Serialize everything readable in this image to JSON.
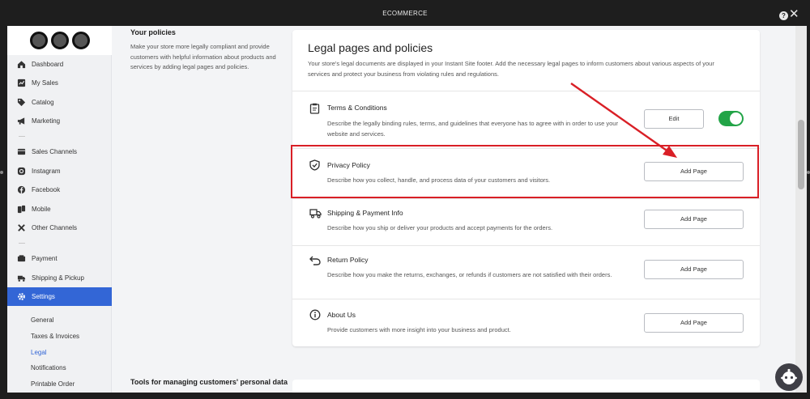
{
  "window": {
    "title": "ECOMMERCE"
  },
  "sidebar": {
    "items": [
      {
        "label": "Dashboard",
        "icon": "home-icon"
      },
      {
        "label": "My Sales",
        "icon": "sales-icon"
      },
      {
        "label": "Catalog",
        "icon": "tag-icon"
      },
      {
        "label": "Marketing",
        "icon": "megaphone-icon"
      },
      {
        "label": "Sales Channels",
        "icon": "channels-icon"
      },
      {
        "label": "Instagram",
        "icon": "instagram-icon"
      },
      {
        "label": "Facebook",
        "icon": "facebook-icon"
      },
      {
        "label": "Mobile",
        "icon": "mobile-icon"
      },
      {
        "label": "Other Channels",
        "icon": "tools-icon"
      },
      {
        "label": "Payment",
        "icon": "wallet-icon"
      },
      {
        "label": "Shipping & Pickup",
        "icon": "truck-icon"
      },
      {
        "label": "Settings",
        "icon": "gear-icon",
        "active": true
      }
    ],
    "subitems": [
      {
        "label": "General"
      },
      {
        "label": "Taxes & Invoices"
      },
      {
        "label": "Legal",
        "active": true
      },
      {
        "label": "Notifications"
      },
      {
        "label": "Printable Order"
      }
    ]
  },
  "policies_section": {
    "heading": "Your policies",
    "description": "Make your store more legally compliant and provide customers with helpful information about products and services by adding legal pages and policies."
  },
  "card": {
    "title": "Legal pages and policies",
    "description": "Your store's legal documents are displayed in your Instant Site footer. Add the necessary legal pages to inform customers about various aspects of your services and protect your business from violating rules and regulations.",
    "rows": [
      {
        "title": "Terms & Conditions",
        "description": "Describe the legally binding rules, terms, and guidelines that everyone has to agree with in order to use your website and services.",
        "button": "Edit",
        "icon": "clipboard-icon",
        "toggle_on": true
      },
      {
        "title": "Privacy Policy",
        "description": "Describe how you collect, handle, and process data of your customers and visitors.",
        "button": "Add Page",
        "icon": "shield-icon"
      },
      {
        "title": "Shipping & Payment Info",
        "description": "Describe how you ship or deliver your products and accept payments for the orders.",
        "button": "Add Page",
        "icon": "truck-icon"
      },
      {
        "title": "Return Policy",
        "description": "Describe how you make the returns, exchanges, or refunds if customers are not satisfied with their orders.",
        "button": "Add Page",
        "icon": "return-arrow-icon"
      },
      {
        "title": "About Us",
        "description": "Provide customers with more insight into your business and product.",
        "button": "Add Page",
        "icon": "info-icon"
      }
    ]
  },
  "tools_section": {
    "heading": "Tools for managing customers' personal data"
  },
  "colors": {
    "accent": "#3366d6",
    "toggle_on": "#22a447",
    "annotation": "#d91f26"
  }
}
